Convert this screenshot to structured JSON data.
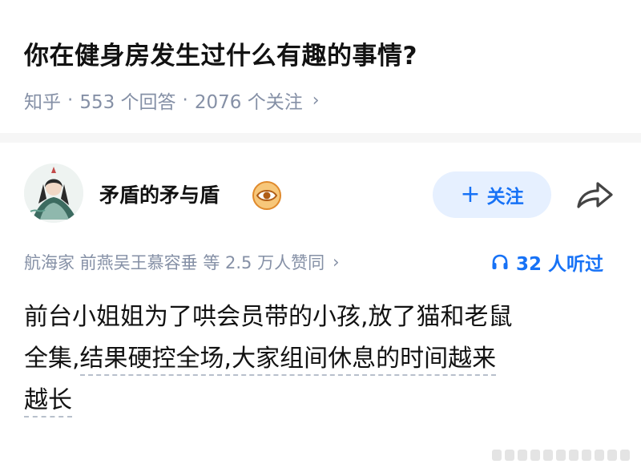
{
  "question": {
    "title": "你在健身房发生过什么有趣的事情?",
    "source": "知乎",
    "answers": "553 个回答",
    "followers": "2076 个关注",
    "chevron": "›"
  },
  "author": {
    "name": "矛盾的矛与盾",
    "badge_icon": "eye-icon",
    "follow_label": "关注",
    "follow_plus": "+",
    "share_icon": "share-icon"
  },
  "endorsement": {
    "text": "航海家 前燕吴王慕容垂 等 2.5 万人赞同",
    "chevron": "›"
  },
  "listen": {
    "icon": "headphones-icon",
    "text": "32 人听过"
  },
  "answer": {
    "line1": "前台小姐姐为了哄会员带的小孩,放了猫和老鼠",
    "line2_plain": "全集,",
    "line2_dashed": "结果硬控全场,大家组间休息的时间越来",
    "line3_dashed": "越长"
  },
  "colors": {
    "accent": "#1772f6",
    "meta": "#8590a6",
    "follow_bg": "#e6f0ff"
  }
}
